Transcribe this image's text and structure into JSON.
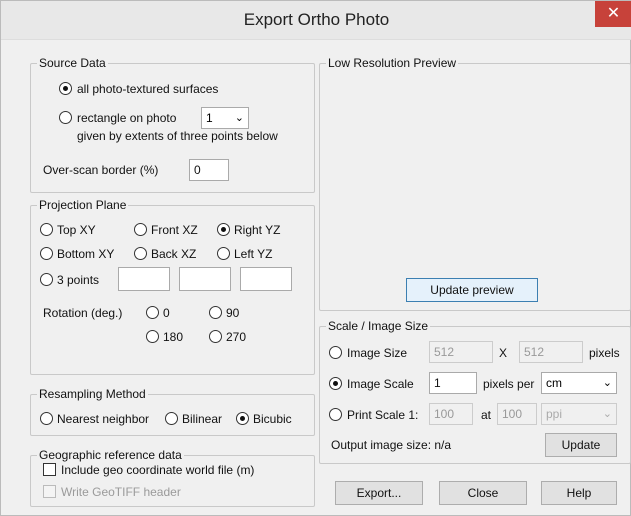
{
  "window": {
    "title": "Export Ortho Photo",
    "close_glyph": "✕"
  },
  "source_data": {
    "group_label": "Source Data",
    "option_all": "all photo-textured surfaces",
    "option_rectangle": "rectangle on photo",
    "rectangle_photo_value": "1",
    "rectangle_note": "given by extents of three points below",
    "overscan_label": "Over-scan border (%)",
    "overscan_value": "0",
    "selected": "all"
  },
  "projection_plane": {
    "group_label": "Projection Plane",
    "options": [
      "Top XY",
      "Front XZ",
      "Right YZ",
      "Bottom XY",
      "Back XZ",
      "Left YZ"
    ],
    "selected": "Right YZ",
    "three_points_label": "3 points",
    "rotation_label": "Rotation (deg.)",
    "rotation_options": [
      "0",
      "90",
      "180",
      "270"
    ]
  },
  "resampling": {
    "group_label": "Resampling Method",
    "options": [
      "Nearest neighbor",
      "Bilinear",
      "Bicubic"
    ],
    "selected": "Bicubic"
  },
  "geo": {
    "group_label": "Geographic reference data",
    "include_world_file": "Include geo coordinate world file (m)",
    "write_geotiff": "Write GeoTIFF header"
  },
  "preview": {
    "group_label": "Low Resolution Preview",
    "update_preview_button": "Update preview"
  },
  "scale": {
    "group_label": "Scale / Image Size",
    "image_size_label": "Image Size",
    "image_width": "512",
    "x_label": "X",
    "image_height": "512",
    "pixels_label": "pixels",
    "image_scale_label": "Image Scale",
    "image_scale_value": "1",
    "pixels_per_label": "pixels per",
    "unit_value": "cm",
    "print_scale_label": "Print Scale 1:",
    "print_scale_value": "100",
    "at_label": "at",
    "dpi_value": "100",
    "ppi_value": "ppi",
    "output_size_label": "Output image size: n/a",
    "update_button": "Update",
    "selected": "Image Scale"
  },
  "footer": {
    "export_button": "Export...",
    "close_button": "Close",
    "help_button": "Help"
  },
  "colors": {
    "close_button_bg": "#c7423a",
    "primary_button_border": "#3c7fb1"
  }
}
